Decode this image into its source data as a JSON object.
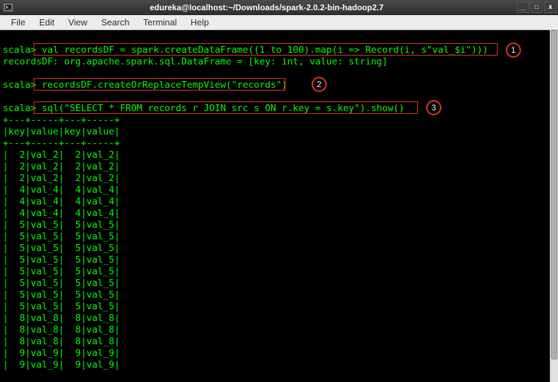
{
  "window": {
    "title": "edureka@localhost:~/Downloads/spark-2.0.2-bin-hadoop2.7",
    "minimize": "_",
    "maximize": "□",
    "close": "x"
  },
  "menubar": {
    "items": [
      "File",
      "Edit",
      "View",
      "Search",
      "Terminal",
      "Help"
    ]
  },
  "annotations": {
    "n1": "1",
    "n2": "2",
    "n3": "3"
  },
  "terminal": {
    "prompt": "scala>",
    "cmd1": "val recordsDF = spark.createDataFrame((1 to 100).map(i => Record(i, s\"val_$i\")))",
    "out1": "recordsDF: org.apache.spark.sql.DataFrame = [key: int, value: string]",
    "cmd2": "recordsDF.createOrReplaceTempView(\"records\")",
    "cmd3": "sql(\"SELECT * FROM records r JOIN src s ON r.key = s.key\").show()",
    "sep": "+---+-----+---+-----+",
    "header": "|key|value|key|value|",
    "rows": [
      "|  2|val_2|  2|val_2|",
      "|  2|val_2|  2|val_2|",
      "|  2|val_2|  2|val_2|",
      "|  4|val_4|  4|val_4|",
      "|  4|val_4|  4|val_4|",
      "|  4|val_4|  4|val_4|",
      "|  5|val_5|  5|val_5|",
      "|  5|val_5|  5|val_5|",
      "|  5|val_5|  5|val_5|",
      "|  5|val_5|  5|val_5|",
      "|  5|val_5|  5|val_5|",
      "|  5|val_5|  5|val_5|",
      "|  5|val_5|  5|val_5|",
      "|  5|val_5|  5|val_5|",
      "|  8|val_8|  8|val_8|",
      "|  8|val_8|  8|val_8|",
      "|  8|val_8|  8|val_8|",
      "|  9|val_9|  9|val_9|",
      "|  9|val_9|  9|val_9|"
    ]
  }
}
